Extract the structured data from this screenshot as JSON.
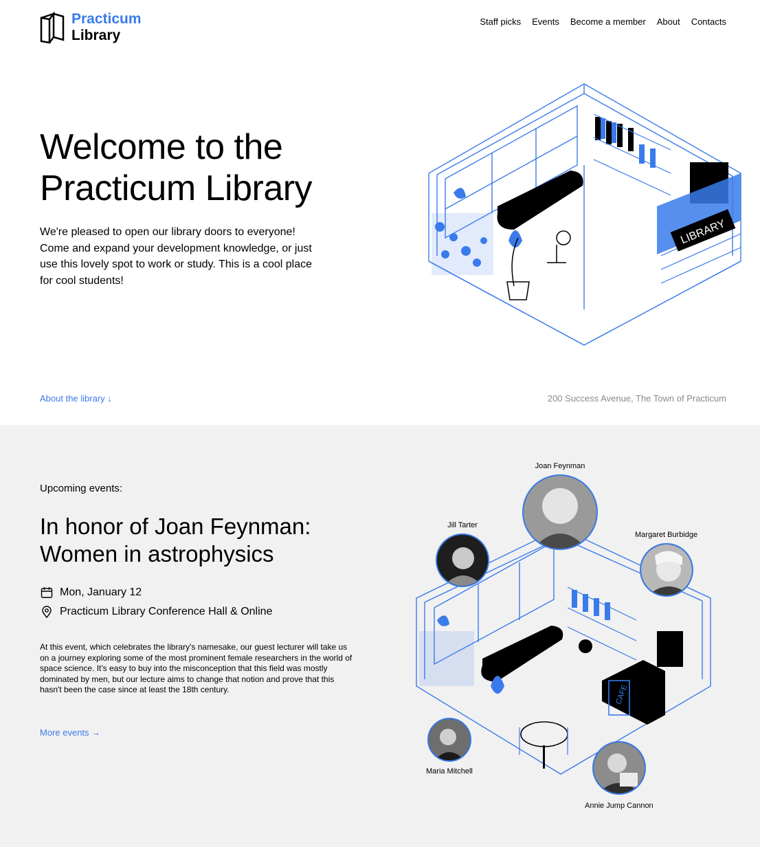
{
  "header": {
    "logo": {
      "line1": "Practicum",
      "line2": "Library"
    },
    "nav": [
      "Staff picks",
      "Events",
      "Become a member",
      "About",
      "Contacts"
    ]
  },
  "hero": {
    "title_line1": "Welcome to the",
    "title_line2": "Practicum Library",
    "text": "We're pleased to open our library doors to everyone! Come and expand your development knowledge, or just use this lovely spot to work or study. This is a cool place for cool students!",
    "about_link": "About the library ↓",
    "address": "200 Success Avenue, The Town of Practicum",
    "sign": "LIBRARY"
  },
  "events": {
    "label": "Upcoming events:",
    "title_line1": "In honor of Joan Feynman:",
    "title_line2": "Women in astrophysics",
    "date": "Mon, January 12",
    "location": "Practicum Library Conference Hall & Online",
    "description": "At this event, which celebrates the library's namesake, our guest lecturer will take us on a journey exploring some of the most prominent female researchers in the world of space science. It's easy to buy into the misconception that this field was mostly dominated by men, but our lecture aims to change that notion and prove that this hasn't been the case since at least the 18th century.",
    "more_link": "More events →",
    "cafe_sign": "CAFE",
    "people": [
      "Joan Feynman",
      "Jill Tarter",
      "Margaret Burbidge",
      "Maria Mitchell",
      "Annie Jump Cannon"
    ]
  },
  "colors": {
    "accent": "#3a7bec",
    "muted": "#8a8a8a",
    "events_bg": "#f1f1f1"
  }
}
